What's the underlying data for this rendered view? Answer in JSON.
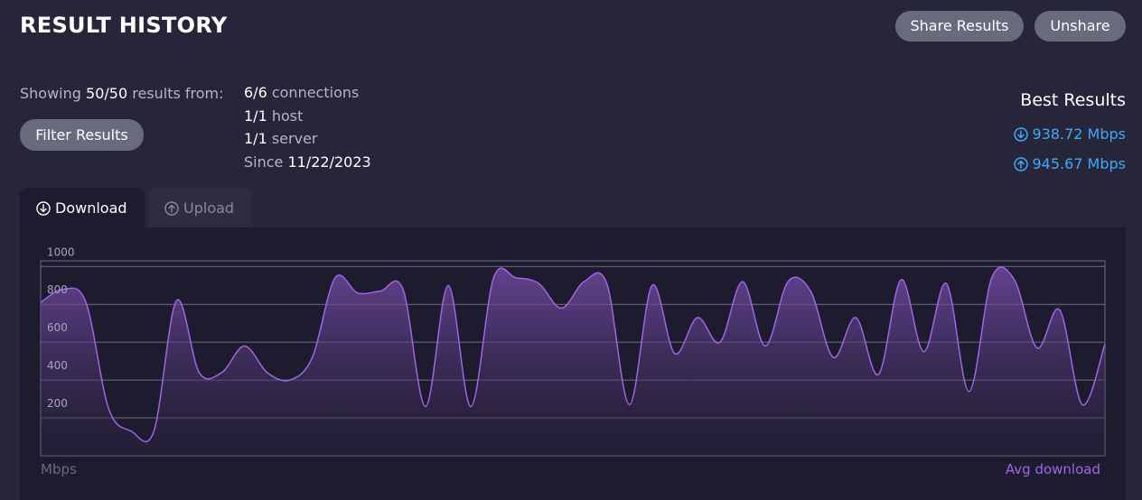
{
  "header": {
    "title": "RESULT HISTORY",
    "share_label": "Share Results",
    "unshare_label": "Unshare"
  },
  "summary": {
    "showing_prefix": "Showing",
    "showing_count": "50/50",
    "showing_suffix": "results from:",
    "filter_label": "Filter Results",
    "connections_count": "6/6",
    "connections_label": "connections",
    "host_count": "1/1",
    "host_label": "host",
    "server_count": "1/1",
    "server_label": "server",
    "since_label": "Since",
    "since_date": "11/22/2023"
  },
  "best": {
    "title": "Best Results",
    "download": "938.72 Mbps",
    "upload": "945.67 Mbps",
    "download_icon": "arrow-down-circle-icon",
    "upload_icon": "arrow-up-circle-icon",
    "color": "#3fa9f5"
  },
  "tabs": [
    {
      "label": "Download",
      "icon": "arrow-down-circle-icon",
      "active": true
    },
    {
      "label": "Upload",
      "icon": "arrow-up-circle-icon",
      "active": false
    }
  ],
  "chart_labels": {
    "unit": "Mbps",
    "series_label": "Avg download"
  },
  "chart_data": {
    "type": "area",
    "ylim": [
      0,
      1030
    ],
    "yticks": [
      200,
      400,
      600,
      800,
      1000
    ],
    "grid": true,
    "line_color": "#a164e6",
    "series": [
      {
        "name": "Avg download",
        "values": [
          810,
          880,
          810,
          250,
          130,
          130,
          820,
          440,
          440,
          580,
          440,
          400,
          520,
          940,
          860,
          870,
          880,
          260,
          900,
          260,
          940,
          940,
          910,
          780,
          920,
          910,
          270,
          900,
          540,
          730,
          600,
          920,
          580,
          920,
          870,
          520,
          730,
          430,
          930,
          550,
          910,
          340,
          940,
          930,
          570,
          770,
          270,
          590
        ]
      }
    ]
  }
}
